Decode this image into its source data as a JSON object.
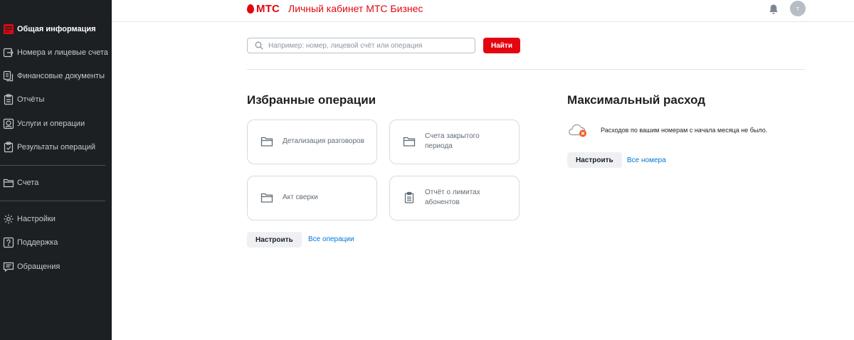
{
  "header": {
    "logo": "МТС",
    "title": "Личный кабинет МТС Бизнес",
    "avatar_initial": "т",
    "bell_icon": "bell-icon",
    "brand_color": "#e30611"
  },
  "sidebar": {
    "items": [
      {
        "label": "Общая информация",
        "icon": "dashboard-icon",
        "active": true
      },
      {
        "label": "Номера и лицевые счета",
        "icon": "numbers-icon"
      },
      {
        "label": "Финансовые документы",
        "icon": "documents-icon"
      },
      {
        "label": "Отчёты",
        "icon": "clipboard-icon"
      },
      {
        "label": "Услуги и операции",
        "icon": "services-icon"
      },
      {
        "label": "Результаты операций",
        "icon": "results-icon"
      },
      {
        "label": "Счета",
        "icon": "folder-icon"
      },
      {
        "label": "Настройки",
        "icon": "gear-icon"
      },
      {
        "label": "Поддержка",
        "icon": "help-icon"
      },
      {
        "label": "Обращения",
        "icon": "chat-icon"
      }
    ]
  },
  "search": {
    "placeholder": "Например: номер, лицевой счёт или операция",
    "value": "",
    "button_label": "Найти"
  },
  "favorites": {
    "title": "Избранные операции",
    "cards": [
      {
        "label": "Детализация разговоров",
        "icon": "folder-icon"
      },
      {
        "label": "Счета закрытого периода",
        "icon": "folder-icon"
      },
      {
        "label": "Акт сверки",
        "icon": "folder-icon"
      },
      {
        "label": "Отчёт о лимитах абонентов",
        "icon": "report-icon"
      }
    ],
    "configure_label": "Настроить",
    "all_link": "Все операции"
  },
  "max_spend": {
    "title": "Максимальный расход",
    "message": "Расходов по вашим номерам с начала месяца не было.",
    "configure_label": "Настроить",
    "all_link": "Все номера"
  }
}
